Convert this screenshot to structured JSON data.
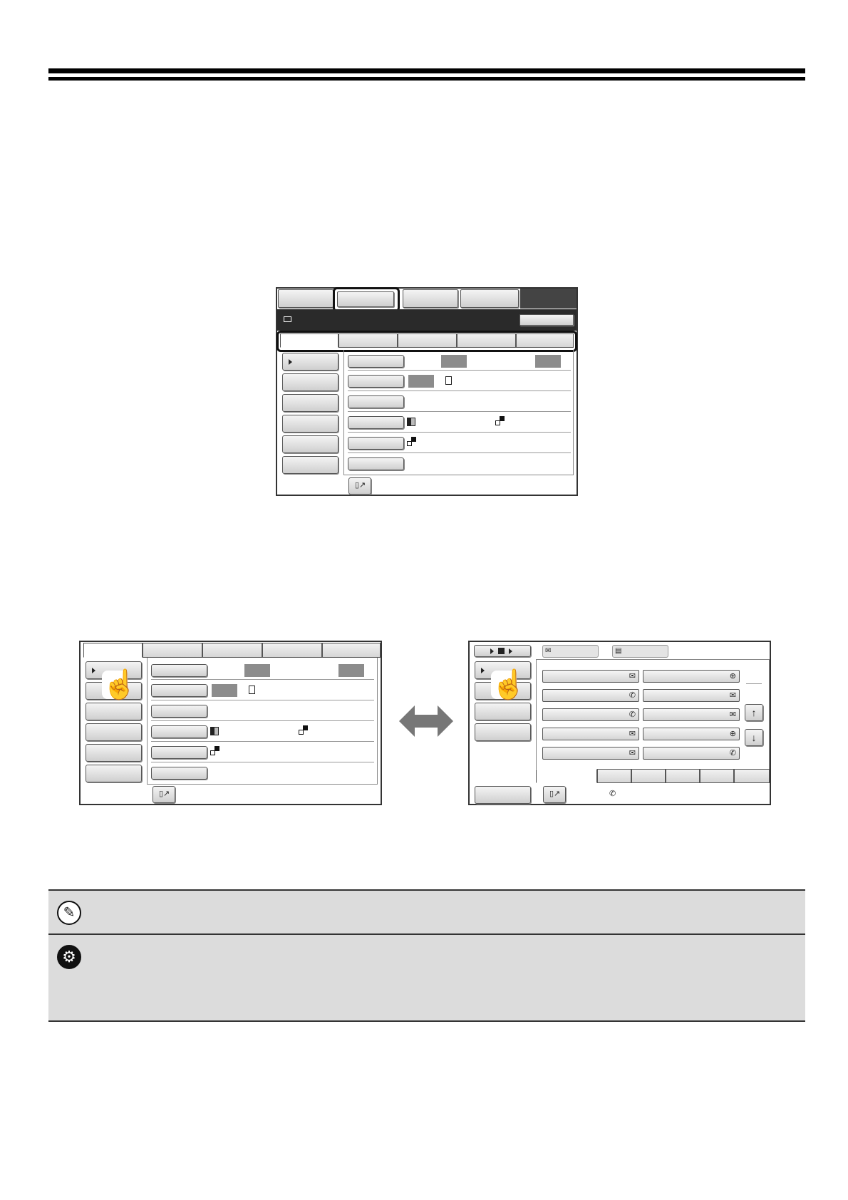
{
  "icons": {
    "note": "pencil-icon",
    "settings": "gear-icon",
    "pointer": "hand-pointer-icon",
    "double_arrow": "double-arrow-icon",
    "email": "envelope-icon",
    "fax": "phone-icon",
    "ftp": "globe-icon",
    "scroll_up": "up-arrow-icon",
    "scroll_down": "down-arrow-icon",
    "toggle": "toggle-icon"
  },
  "colors": {
    "rule": "#000000",
    "note_bg": "#dcdcdc",
    "panel_title_bar": "#2a2a2a",
    "gray_block": "#8c8c8c"
  },
  "glyphs": {
    "arrow_up": "↑",
    "arrow_down": "↓",
    "arrow_left_right": "⟷",
    "envelope": "✉",
    "phone": "✆",
    "pencil": "✎",
    "gear": "⚙",
    "hand": "☝"
  }
}
